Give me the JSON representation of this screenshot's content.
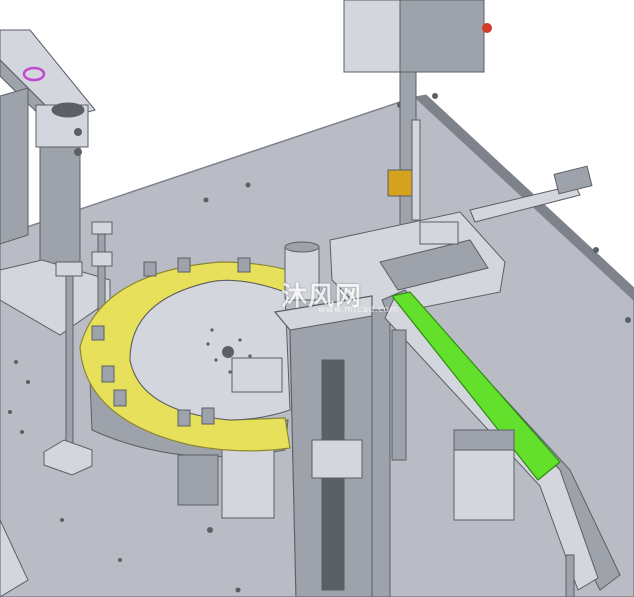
{
  "watermark": {
    "text": "沐风网",
    "subtext": "www.mfcad.com"
  },
  "colors": {
    "background": "#ffffff",
    "base_plate": "#b9bcc5",
    "base_plate_edge": "#7e828b",
    "metal_light": "#d3d6dc",
    "metal_mid": "#9ea2aa",
    "metal_dark": "#5b5f66",
    "rotary_table": "#e6e05a",
    "rotary_table_edge": "#8b8730",
    "conveyor_belt": "#63e02b",
    "conveyor_belt_edge": "#2f8a12",
    "bronze_bushing": "#d4a21c",
    "magenta_ring": "#c04bd0",
    "red_button": "#d23a2a"
  },
  "components": [
    "base-plate",
    "rotary-feeder-table",
    "pneumatic-cylinder",
    "conveyor-belt",
    "vertical-column",
    "gantry-arm",
    "support-posts"
  ]
}
